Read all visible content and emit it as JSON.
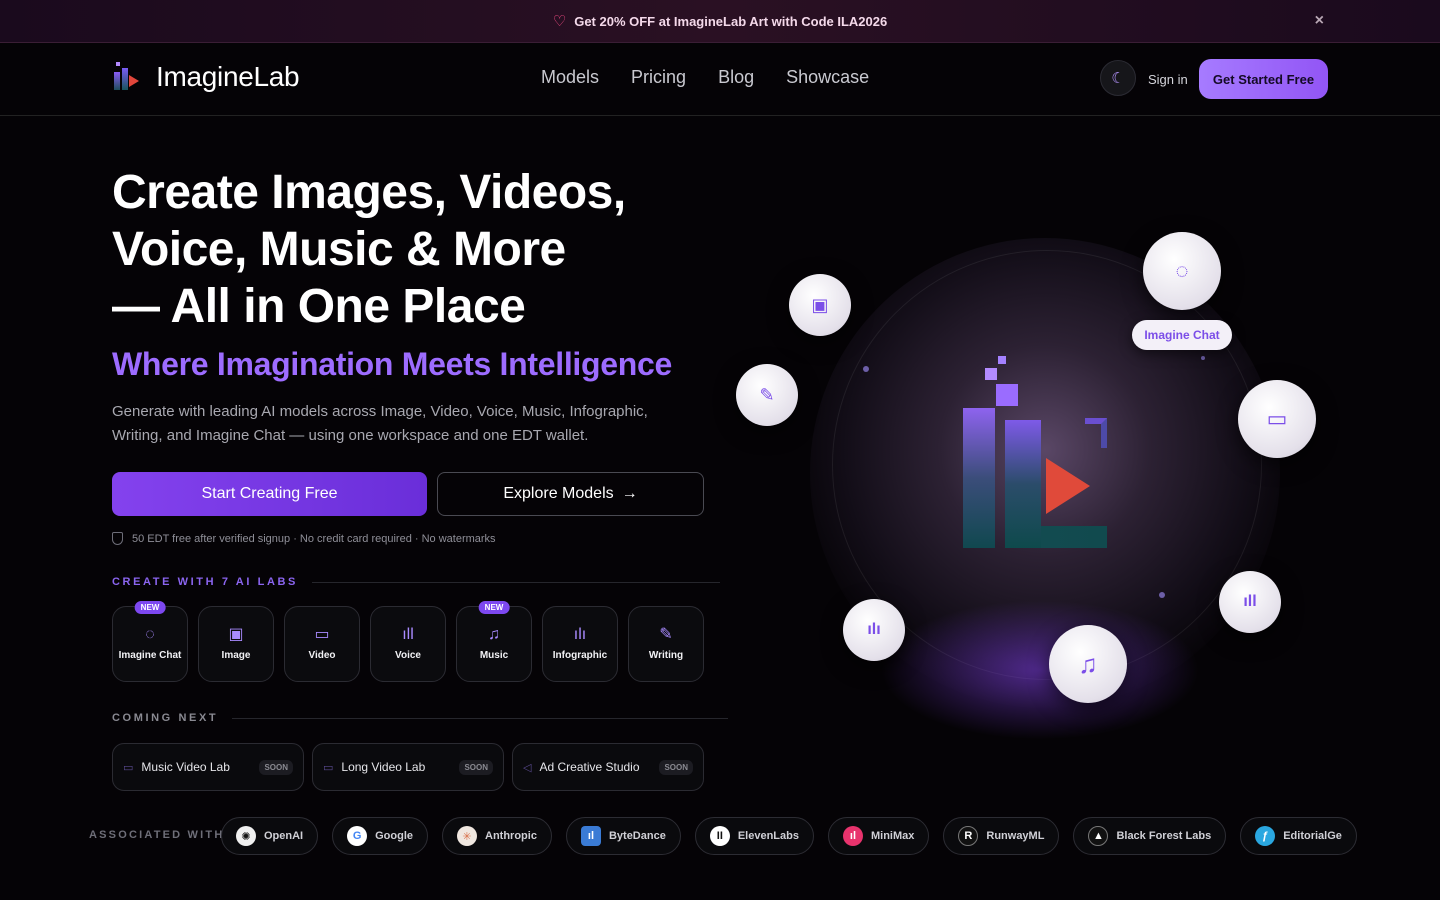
{
  "promo": {
    "text": "Get 20% OFF at ImagineLab Art with Code ILA2026",
    "close": "×"
  },
  "brand": {
    "name": "ImagineLab"
  },
  "nav": {
    "items": [
      {
        "label": "Models"
      },
      {
        "label": "Pricing"
      },
      {
        "label": "Blog"
      },
      {
        "label": "Showcase"
      }
    ],
    "sign_in": "Sign in",
    "get_started": "Get Started Free",
    "theme_icon": "moon-icon"
  },
  "hero": {
    "headline_1": "Create Images, Videos,",
    "headline_2": "Voice, Music & More",
    "headline_3": "— All in One Place",
    "tagline": "Where Imagination Meets Intelligence",
    "description": "Generate with leading AI models across Image, Video, Voice, Music, Infographic, Writing, and Imagine Chat — using one workspace and one EDT wallet.",
    "primary_cta": "Start Creating Free",
    "secondary_cta": "Explore Models",
    "secondary_arrow": "→",
    "note": "50 EDT free after verified signup · No credit card required · No watermarks"
  },
  "labs": {
    "label": "CREATE WITH 7 AI LABS",
    "items": [
      {
        "name": "Imagine Chat",
        "icon": "chat-icon",
        "glyph": "◌",
        "badge": "NEW"
      },
      {
        "name": "Image",
        "icon": "image-icon",
        "glyph": "▣",
        "badge": ""
      },
      {
        "name": "Video",
        "icon": "video-icon",
        "glyph": "▭",
        "badge": ""
      },
      {
        "name": "Voice",
        "icon": "waveform-icon",
        "glyph": "ıll",
        "badge": ""
      },
      {
        "name": "Music",
        "icon": "music-note-icon",
        "glyph": "♫",
        "badge": "NEW"
      },
      {
        "name": "Infographic",
        "icon": "bar-chart-icon",
        "glyph": "ılı",
        "badge": ""
      },
      {
        "name": "Writing",
        "icon": "pen-icon",
        "glyph": "✎",
        "badge": ""
      }
    ]
  },
  "coming_next": {
    "label": "COMING NEXT",
    "items": [
      {
        "name": "Music Video Lab",
        "soon": "SOON",
        "icon": "video-icon",
        "glyph": "▭"
      },
      {
        "name": "Long Video Lab",
        "soon": "SOON",
        "icon": "video-icon",
        "glyph": "▭"
      },
      {
        "name": "Ad Creative Studio",
        "soon": "SOON",
        "icon": "megaphone-icon",
        "glyph": "◁"
      }
    ]
  },
  "associated": {
    "label": "ASSOCIATED WITH",
    "partners": [
      {
        "name": "OpenAI",
        "icon": "openai-icon",
        "glyph": "✺",
        "color": "#1a1a1a"
      },
      {
        "name": "Google",
        "icon": "google-icon",
        "glyph": "G",
        "color": "#ffffff"
      },
      {
        "name": "Anthropic",
        "icon": "anthropic-icon",
        "glyph": "✳",
        "color": "#f0e7e0"
      },
      {
        "name": "ByteDance",
        "icon": "bytedance-icon",
        "glyph": "ıl",
        "color": "#3a7bd5"
      },
      {
        "name": "ElevenLabs",
        "icon": "elevenlabs-icon",
        "glyph": "II",
        "color": "#ffffff"
      },
      {
        "name": "MiniMax",
        "icon": "minimax-icon",
        "glyph": "ıl",
        "color": "#e8336d"
      },
      {
        "name": "RunwayML",
        "icon": "runway-icon",
        "glyph": "R",
        "color": "#111111"
      },
      {
        "name": "Black Forest Labs",
        "icon": "bfl-icon",
        "glyph": "▲",
        "color": "#111111"
      },
      {
        "name": "EditorialGe",
        "icon": "editorialge-icon",
        "glyph": "ƒ",
        "color": "#2aa7e0"
      }
    ]
  },
  "visual": {
    "chat_chip": "Imagine Chat",
    "bubbles": [
      {
        "icon": "image-icon",
        "glyph": "▣"
      },
      {
        "icon": "pen-icon",
        "glyph": "✎"
      },
      {
        "icon": "chat-icon",
        "glyph": "◌"
      },
      {
        "icon": "video-icon",
        "glyph": "▭"
      },
      {
        "icon": "waveform-icon",
        "glyph": "ıll"
      },
      {
        "icon": "bar-chart-icon",
        "glyph": "ılı"
      },
      {
        "icon": "music-note-icon",
        "glyph": "♫"
      }
    ]
  }
}
